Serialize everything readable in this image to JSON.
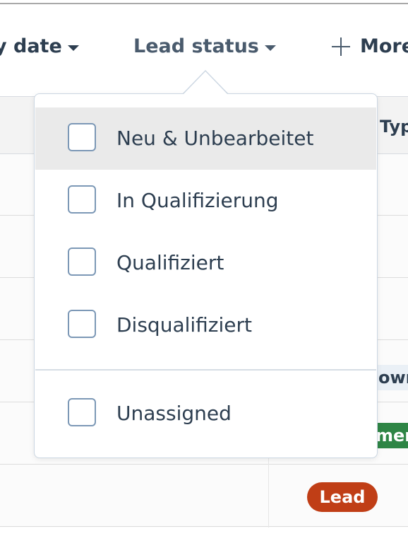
{
  "filters": {
    "date_label": "y date",
    "lead_status_label": "Lead status",
    "more_label": "More"
  },
  "table": {
    "column_type_header": "Typ",
    "tags": {
      "own": "own",
      "mer": "mer",
      "lead": "Lead"
    }
  },
  "dropdown": {
    "options": [
      {
        "label": "Neu & Unbearbeitet",
        "checked": false
      },
      {
        "label": "In Qualifizierung",
        "checked": false
      },
      {
        "label": "Qualifiziert",
        "checked": false
      },
      {
        "label": "Disqualifiziert",
        "checked": false
      }
    ],
    "unassigned_label": "Unassigned"
  },
  "colors": {
    "lead_tag": "#c03e16",
    "customer_tag": "#2e8545",
    "hover_row": "#eaeaea",
    "checkbox_border": "#7c98b6"
  }
}
